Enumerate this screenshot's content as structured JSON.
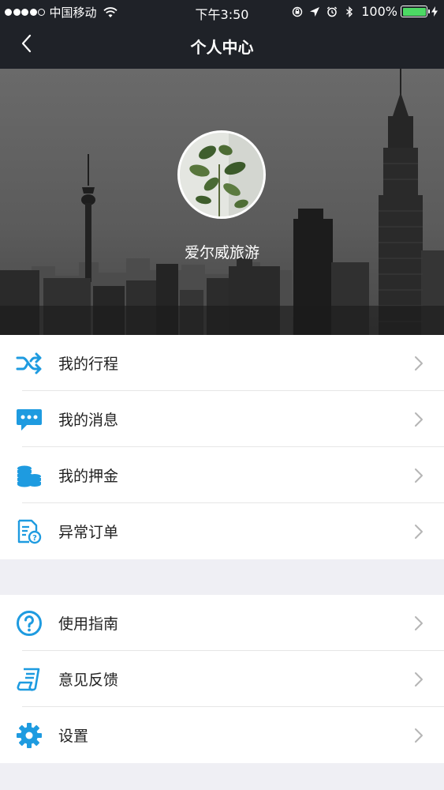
{
  "status_bar": {
    "carrier": "中国移动",
    "time": "下午3:50",
    "battery": "100%",
    "battery_color": "#4cd964"
  },
  "nav": {
    "title": "个人中心",
    "back_icon": "chevron-left-icon"
  },
  "profile": {
    "name": "爱尔威旅游"
  },
  "menu_group_1": [
    {
      "label": "我的行程",
      "icon": "shuffle-icon"
    },
    {
      "label": "我的消息",
      "icon": "message-icon"
    },
    {
      "label": "我的押金",
      "icon": "coins-icon"
    },
    {
      "label": "异常订单",
      "icon": "abnormal-order-icon"
    }
  ],
  "menu_group_2": [
    {
      "label": "使用指南",
      "icon": "help-icon"
    },
    {
      "label": "意见反馈",
      "icon": "feedback-icon"
    },
    {
      "label": "设置",
      "icon": "gear-icon"
    }
  ],
  "colors": {
    "accent": "#1e9be0",
    "nav_bg": "#1f2228"
  }
}
